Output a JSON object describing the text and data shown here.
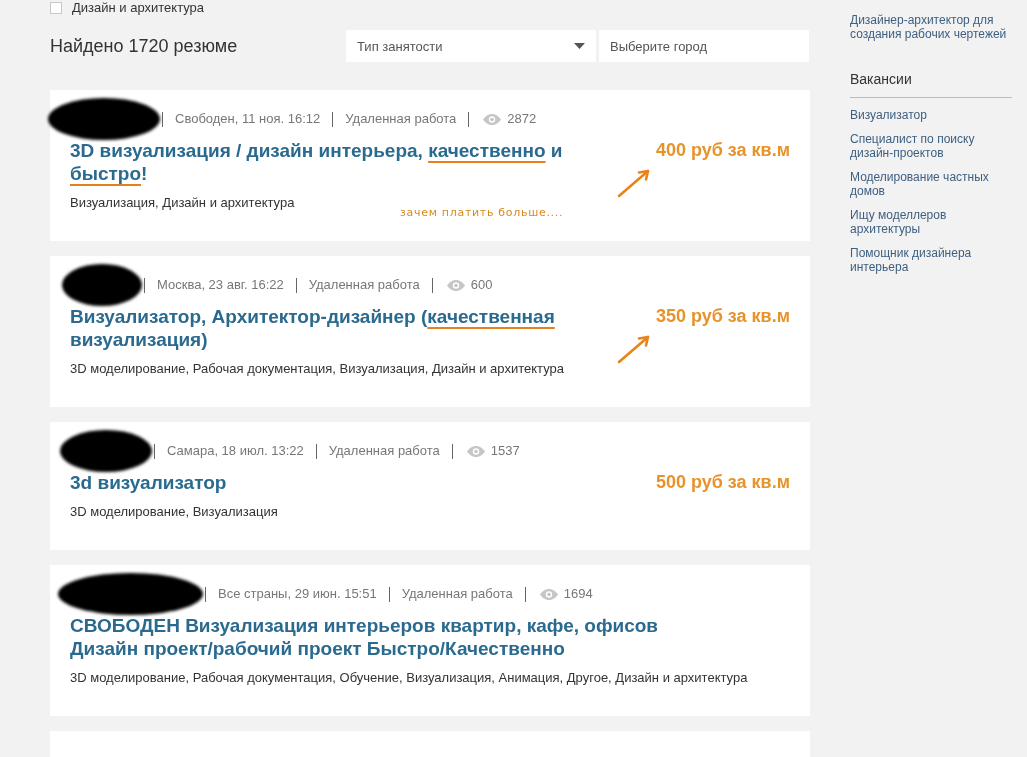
{
  "filter_checkbox": {
    "label": "Дизайн и архитектура",
    "checked": false
  },
  "results_heading": "Найдено 1720 резюме",
  "employment_dropdown": {
    "value": "Тип занятости"
  },
  "city_field": {
    "placeholder": "Выберите город"
  },
  "resumes": [
    {
      "place_time": "Свободен, 11 ноя. 16:12",
      "work_type": "Удаленная работа",
      "views": "2872",
      "title": [
        {
          "text": "3D визуализация / дизайн интерьера, ",
          "underlined": false
        },
        {
          "text": "качественно",
          "underlined": true
        },
        {
          "text": " и ",
          "underlined": false
        },
        {
          "text": "быстро",
          "underlined": true
        },
        {
          "text": "!",
          "underlined": false
        }
      ],
      "categories": "Визуализация, Дизайн и архитектура",
      "price": "400 руб за кв.м",
      "arrow": true,
      "note": "зачем платить больше...."
    },
    {
      "place_time": "Москва, 23 авг. 16:22",
      "work_type": "Удаленная работа",
      "views": "600",
      "title": [
        {
          "text": "Визуализатор, Архитектор-дизайнер (",
          "underlined": false
        },
        {
          "text": "качественная",
          "underlined": true
        },
        {
          "text": " визуализация)",
          "underlined": false
        }
      ],
      "categories": "3D моделирование, Рабочая документация, Визуализация, Дизайн и архитектура",
      "price": "350 руб за кв.м",
      "arrow": true
    },
    {
      "place_time": "Самара, 18 июл. 13:22",
      "work_type": "Удаленная работа",
      "views": "1537",
      "title": [
        {
          "text": "3d визуализатор",
          "underlined": false
        }
      ],
      "categories": "3D моделирование, Визуализация",
      "price": "500 руб за кв.м",
      "arrow": false
    },
    {
      "place_time": "Все страны, 29 июн. 15:51",
      "work_type": "Удаленная работа",
      "views": "1694",
      "title": [
        {
          "text": "СВОБОДЕН Визуализация интерьеров квартир, кафе, офисов Дизайн проект/рабочий проект Быстро/Качественно",
          "underlined": false
        }
      ],
      "categories": "3D моделирование, Рабочая документация, Обучение, Визуализация, Анимация, Другое, Дизайн и архитектура",
      "arrow": false
    }
  ],
  "sidebar": {
    "link": "Дизайнер-архитектор для создания рабочих чертежей",
    "vacancies": {
      "title": "Вакансии",
      "items": [
        "Визуализатор",
        "Специалист по поиску дизайн-проектов",
        "Моделирование частных домов",
        "Ищу моделлеров архитектуры",
        "Помощник дизайнера интерьера"
      ]
    }
  }
}
